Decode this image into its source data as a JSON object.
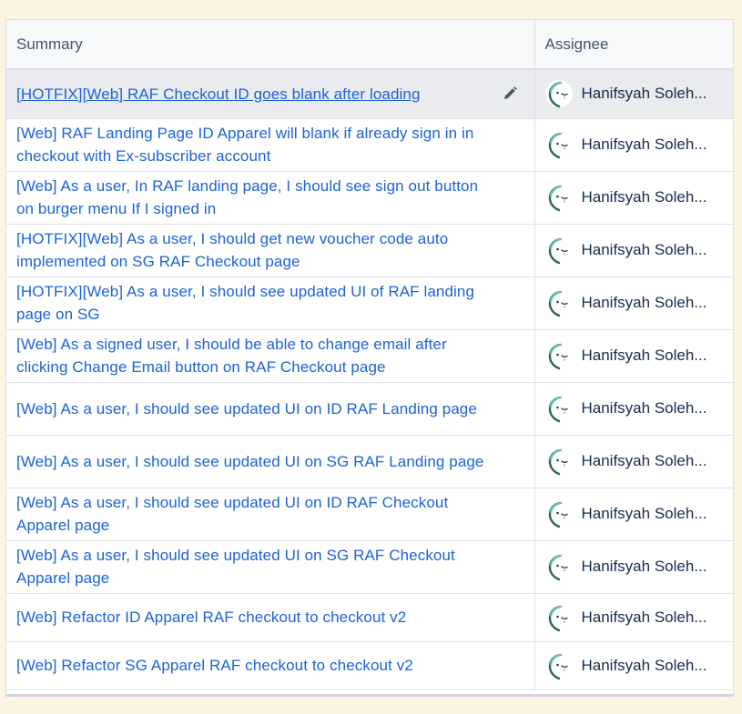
{
  "table": {
    "headers": {
      "summary": "Summary",
      "assignee": "Assignee"
    },
    "rows": [
      {
        "summary": "[HOTFIX][Web] RAF Checkout ID goes blank after loading",
        "assignee": "Hanifsyah Soleh..."
      },
      {
        "summary": "[Web] RAF Landing Page ID Apparel will blank if already sign in in checkout with Ex-subscriber account",
        "assignee": "Hanifsyah Soleh..."
      },
      {
        "summary": "[Web] As a user, In RAF landing page, I should see sign out button on burger menu If I signed in",
        "assignee": "Hanifsyah Soleh..."
      },
      {
        "summary": "[HOTFIX][Web] As a user, I should get new voucher code auto implemented on SG RAF Checkout page",
        "assignee": "Hanifsyah Soleh..."
      },
      {
        "summary": "[HOTFIX][Web] As a user, I should see updated UI of RAF landing page on SG",
        "assignee": "Hanifsyah Soleh..."
      },
      {
        "summary": "[Web] As a signed user, I should be able to change email after clicking Change Email button on RAF Checkout page",
        "assignee": "Hanifsyah Soleh..."
      },
      {
        "summary": "[Web] As a user, I should see updated UI on ID RAF Landing page",
        "assignee": "Hanifsyah Soleh..."
      },
      {
        "summary": "[Web] As a user, I should see updated UI on SG RAF Landing page",
        "assignee": "Hanifsyah Soleh..."
      },
      {
        "summary": "[Web] As a user, I should see updated UI on ID RAF Checkout Apparel page",
        "assignee": "Hanifsyah Soleh..."
      },
      {
        "summary": "[Web] As a user, I should see updated UI on SG RAF Checkout Apparel page",
        "assignee": "Hanifsyah Soleh..."
      },
      {
        "summary": "[Web] Refactor ID Apparel RAF checkout to checkout v2",
        "assignee": "Hanifsyah Soleh..."
      },
      {
        "summary": "[Web] Refactor SG Apparel RAF checkout to checkout v2",
        "assignee": "Hanifsyah Soleh..."
      }
    ],
    "highlighted_row": 0
  },
  "icons": {
    "edit": "pencil-icon",
    "avatar": "avatar-icon"
  },
  "colors": {
    "link": "#1d62d6",
    "row_highlight": "#e9ebee",
    "background": "#fcf3e2"
  }
}
